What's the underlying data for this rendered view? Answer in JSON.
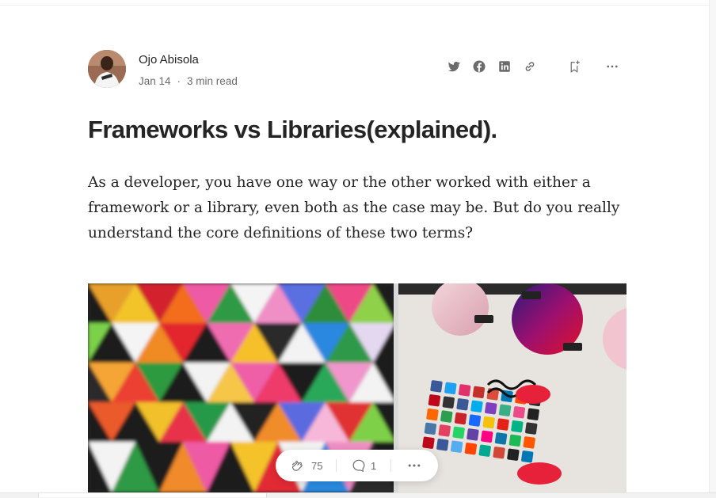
{
  "author": {
    "name": "Ojo Abisola",
    "date": "Jan 14",
    "separator": "·",
    "read_time": "3 min read"
  },
  "share_icons": [
    "twitter-icon",
    "facebook-icon",
    "linkedin-icon",
    "link-icon",
    "bookmark-add-icon",
    "more-icon"
  ],
  "article": {
    "title": "Frameworks vs Libraries(explained).",
    "intro": "As a developer, you have one way or the other worked with either a framework or a library, even both as the case may be. But do you really understand the core definitions of these two terms?"
  },
  "reactions": {
    "claps": "75",
    "responses": "1"
  },
  "colors": {
    "text": "#242424",
    "muted": "#6b6b6b",
    "icon": "#6b6b6b"
  }
}
